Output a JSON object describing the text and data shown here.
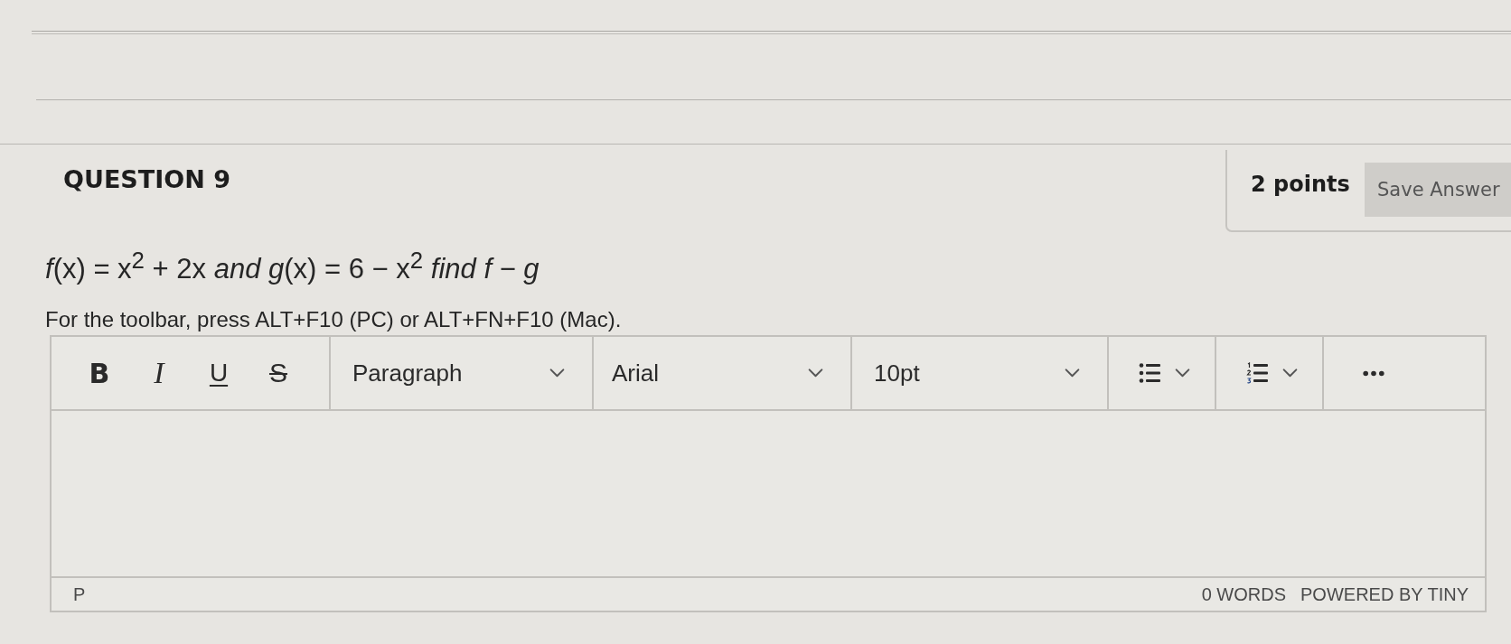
{
  "question": {
    "title": "QUESTION 9",
    "points": "2 points",
    "save_button": "Save Answer",
    "text": "*f*(x) = x$^{2}$ + 2x *and g*(x) = 6 − x$^{2}$ *find f* − *g*",
    "instructions": "For the toolbar, press ALT+F10 (PC) or ALT+FN+F10 (Mac)."
  },
  "editor": {
    "format_buttons": [
      {
        "label": "B",
        "kind": "bold"
      },
      {
        "label": "I",
        "kind": "italic"
      },
      {
        "label": "U",
        "kind": "underline"
      },
      {
        "label": "S",
        "kind": "strikethrough"
      }
    ],
    "dropdowns": [
      {
        "kind": "block_format",
        "value": "Paragraph"
      },
      {
        "kind": "font_family",
        "value": "Arial"
      },
      {
        "kind": "font_size",
        "value": "10pt"
      }
    ],
    "list_buttons": [
      {
        "kind": "bullet"
      },
      {
        "kind": "numbered"
      }
    ],
    "status_bar": {
      "path": "P",
      "word_count": "0 WORDS",
      "branding": "POWERED BY TINY"
    }
  }
}
